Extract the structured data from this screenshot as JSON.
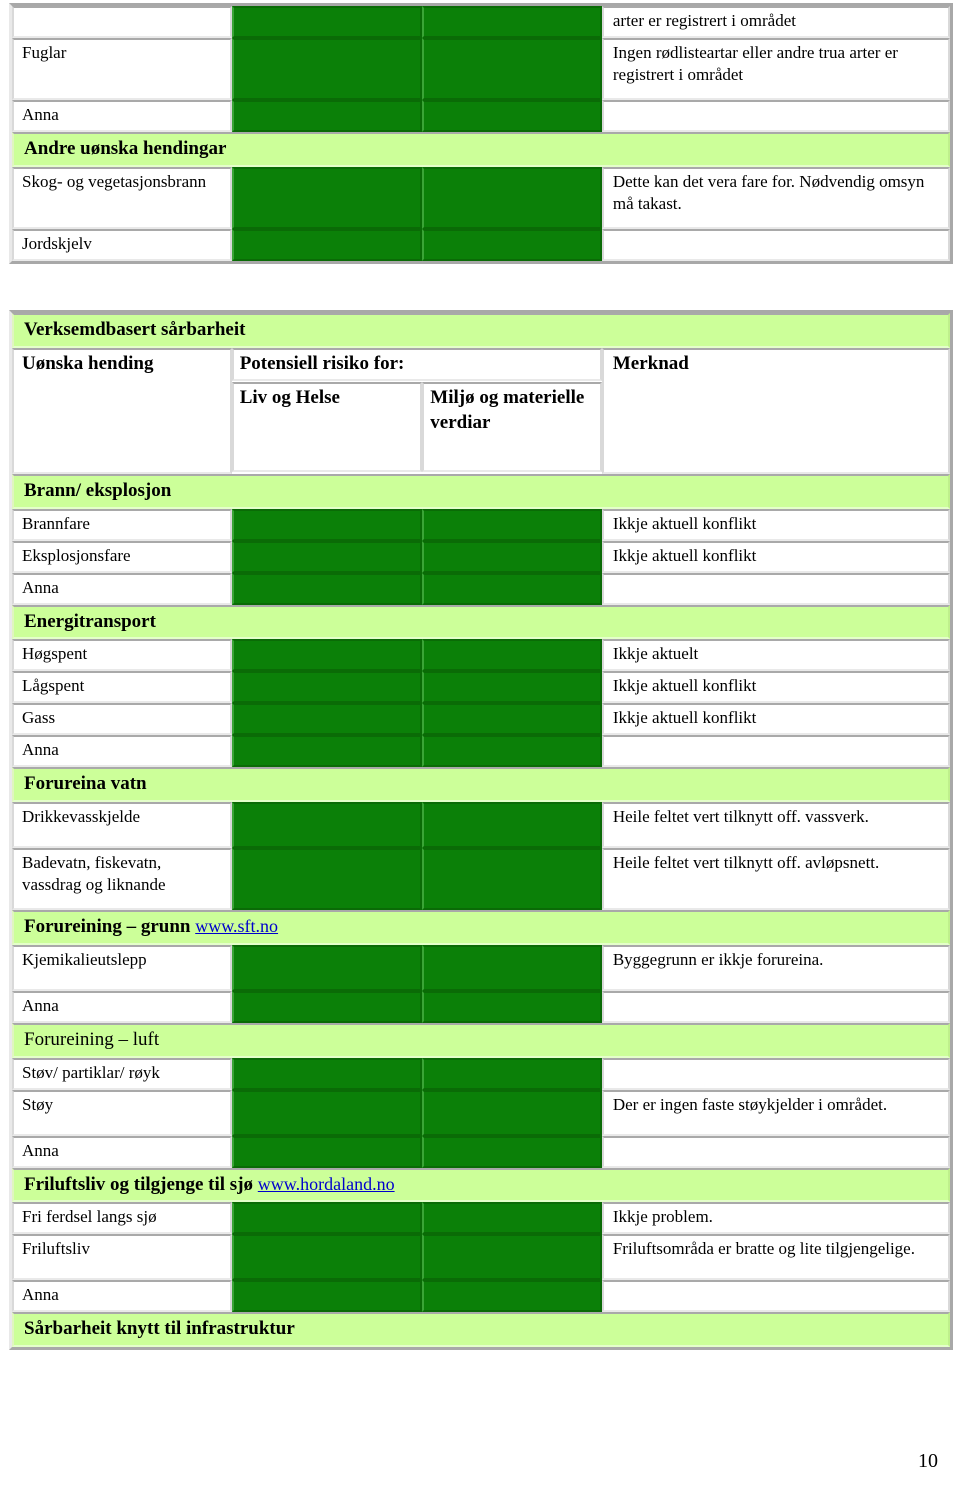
{
  "document": {
    "page_number": "10"
  },
  "top_table": {
    "rows": [
      {
        "type": "data",
        "label": "",
        "merknad": "arter er registrert i området",
        "green": true,
        "height": "h1"
      },
      {
        "type": "data",
        "label": "Fuglar",
        "merknad": "Ingen rødlisteartar eller andre trua arter er registrert i området",
        "green": true,
        "height": "h2"
      },
      {
        "type": "data",
        "label": "Anna",
        "merknad": "",
        "green": true,
        "height": "h1"
      },
      {
        "type": "banner",
        "label": "Andre uønska hendingar",
        "bold": true
      },
      {
        "type": "data",
        "label": "Skog- og vegetasjonsbrann",
        "merknad": "Dette kan det vera fare for. Nødvendig omsyn må takast.",
        "green": true,
        "height": "h2"
      },
      {
        "type": "data",
        "label": "Jordskjelv",
        "merknad": "",
        "green": true,
        "height": "h1"
      }
    ]
  },
  "main_table": {
    "title": "Verksemdbasert sårbarheit",
    "headers": {
      "uonska_hending": "Uønska hending",
      "potensiell_risiko": "Potensiell risiko for:",
      "liv_og_helse": "Liv og Helse",
      "miljo_materielle": "Miljø og materielle verdiar",
      "merknad": "Merknad"
    },
    "sections": [
      {
        "banner": "Brann/ eksplosjon",
        "bold": true,
        "link": "",
        "rows": [
          {
            "label": "Brannfare",
            "merknad": "Ikkje aktuell konflikt",
            "height": "h1"
          },
          {
            "label": "Eksplosjonsfare",
            "merknad": "Ikkje aktuell konflikt",
            "height": "h1"
          },
          {
            "label": "Anna",
            "merknad": "",
            "height": "h1"
          }
        ]
      },
      {
        "banner": "Energitransport",
        "bold": true,
        "link": "",
        "rows": [
          {
            "label": "Høgspent",
            "merknad": "Ikkje aktuelt",
            "height": "h1"
          },
          {
            "label": "Lågspent",
            "merknad": "Ikkje aktuell konflikt",
            "height": "h1"
          },
          {
            "label": "Gass",
            "merknad": "Ikkje aktuell konflikt",
            "height": "h1"
          },
          {
            "label": "Anna",
            "merknad": "",
            "height": "h1"
          }
        ]
      },
      {
        "banner": "Forureina vatn",
        "bold": true,
        "link": "",
        "rows": [
          {
            "label": "Drikkevasskjelde",
            "merknad": "Heile feltet vert tilknytt off. vassverk.",
            "height": "h3"
          },
          {
            "label": "Badevatn, fiskevatn, vassdrag og liknande",
            "merknad": "Heile feltet vert tilknytt off. avløpsnett.",
            "height": "h2"
          }
        ]
      },
      {
        "banner": "Forureining – grunn",
        "bold": true,
        "link": "www.sft.no",
        "rows": [
          {
            "label": "Kjemikalieutslepp",
            "merknad": "Byggegrunn er ikkje forureina.",
            "height": "h3"
          },
          {
            "label": "Anna",
            "merknad": "",
            "height": "h1"
          }
        ]
      },
      {
        "banner": "Forureining – luft",
        "bold": false,
        "link": "",
        "rows": [
          {
            "label": "Støv/ partiklar/ røyk",
            "merknad": "",
            "height": "h1"
          },
          {
            "label": "Støy",
            "merknad": "Der er ingen faste støykjelder i området.",
            "height": "h3"
          },
          {
            "label": "Anna",
            "merknad": "",
            "height": "h1"
          }
        ]
      },
      {
        "banner": "Friluftsliv og tilgjenge til sjø",
        "bold": true,
        "link": "www.hordaland.no",
        "rows": [
          {
            "label": "Fri ferdsel langs sjø",
            "merknad": "Ikkje problem.",
            "height": "h1"
          },
          {
            "label": "Friluftsliv",
            "merknad": "Friluftsområda er bratte og lite tilgjengelige.",
            "height": "h3"
          },
          {
            "label": "Anna",
            "merknad": "",
            "height": "h1"
          }
        ]
      },
      {
        "banner": "Sårbarheit knytt til infrastruktur",
        "bold": true,
        "link": "",
        "rows": []
      }
    ]
  },
  "colors": {
    "risk_green": "#0b8008",
    "banner_green": "#ccff99",
    "link_blue": "#0000cc",
    "frame_gray": "#a8a8a8"
  }
}
